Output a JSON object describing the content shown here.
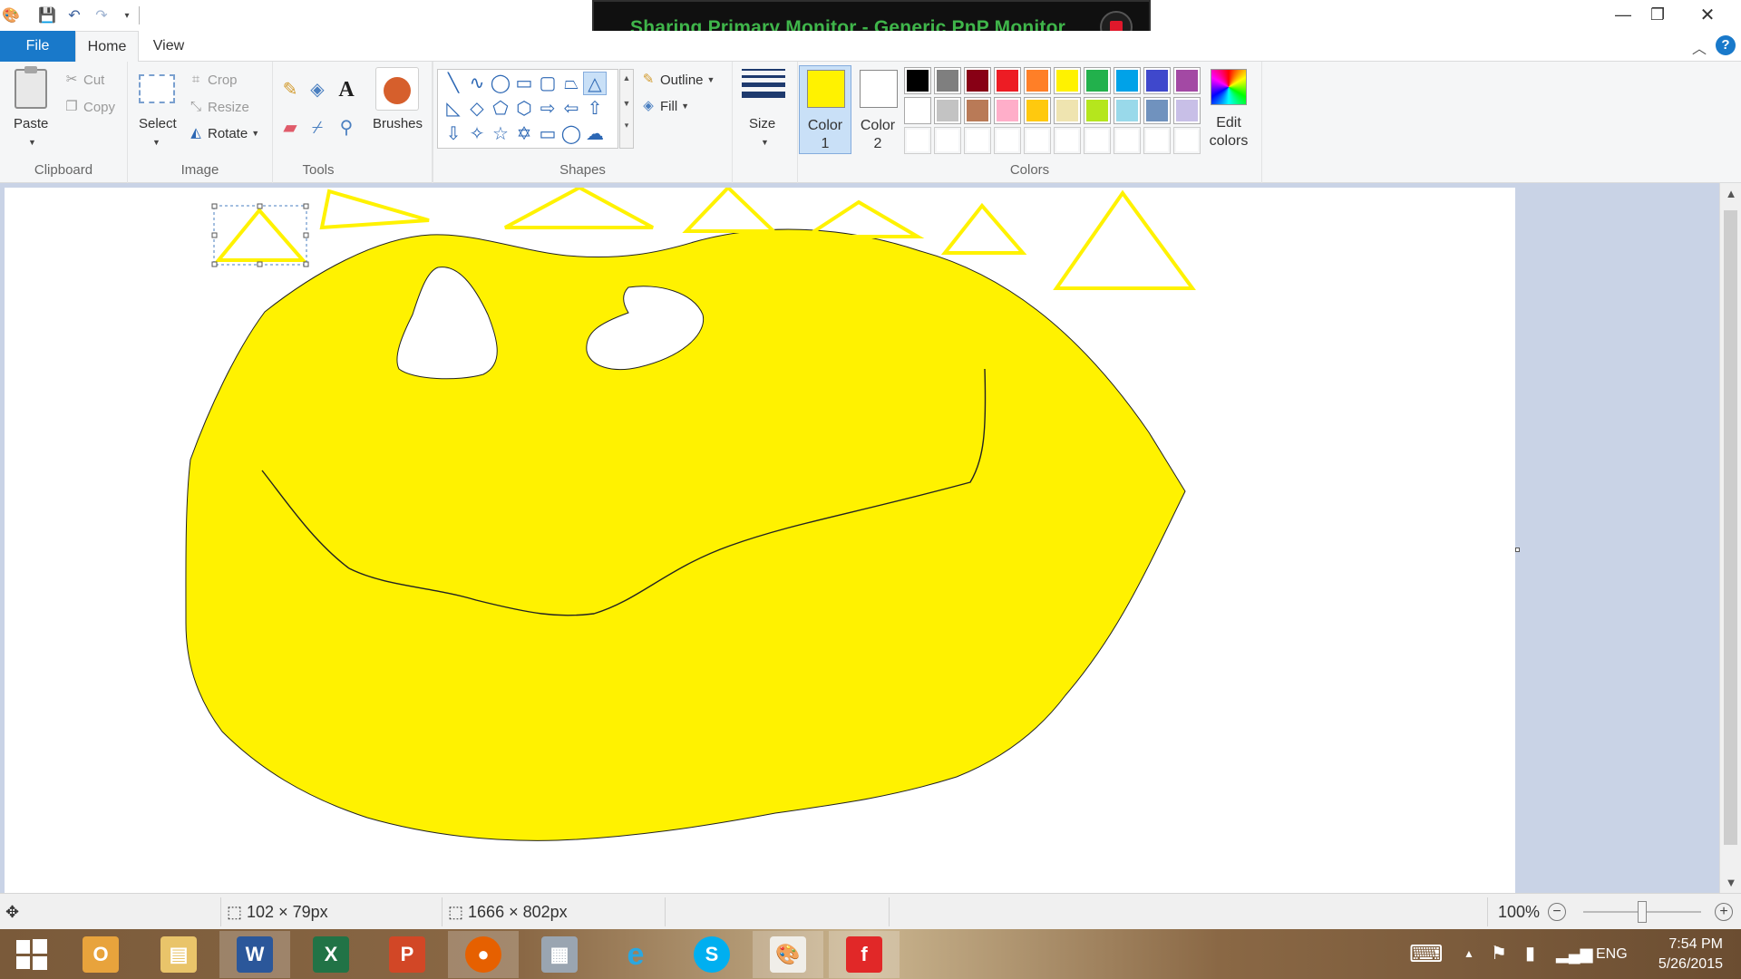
{
  "window": {
    "minimize": "—",
    "restore": "❐",
    "close": "✕"
  },
  "sharing": {
    "text": "Sharing Primary Monitor - Generic PnP Monitor"
  },
  "tabs": {
    "file": "File",
    "home": "Home",
    "view": "View"
  },
  "clipboard": {
    "paste": "Paste",
    "cut": "Cut",
    "copy": "Copy",
    "group": "Clipboard"
  },
  "image": {
    "select": "Select",
    "crop": "Crop",
    "resize": "Resize",
    "rotate": "Rotate",
    "group": "Image"
  },
  "tools": {
    "group": "Tools",
    "text_tool": "A"
  },
  "brushes": {
    "label": "Brushes"
  },
  "shapes": {
    "outline": "Outline",
    "fill": "Fill",
    "group": "Shapes"
  },
  "size": {
    "label": "Size"
  },
  "colors": {
    "color1_label": "Color",
    "color1_num": "1",
    "color2_label": "Color",
    "color2_num": "2",
    "color1": "#FFF200",
    "color2": "#FFFFFF",
    "edit_label": "Edit",
    "edit_label2": "colors",
    "group": "Colors",
    "palette_row1": [
      "#000000",
      "#7F7F7F",
      "#880015",
      "#ED1C24",
      "#FF7F27",
      "#FFF200",
      "#22B14C",
      "#00A2E8",
      "#3F48CC",
      "#A349A4"
    ],
    "palette_row2": [
      "#FFFFFF",
      "#C3C3C3",
      "#B97A57",
      "#FFAEC9",
      "#FFC90E",
      "#EFE4B0",
      "#B5E61D",
      "#99D9EA",
      "#7092BE",
      "#C8BFE7"
    ]
  },
  "status": {
    "selection_size": "102 × 79px",
    "image_size": "1666 × 802px",
    "zoom": "100%"
  },
  "taskbar": {
    "language": "ENG",
    "time": "7:54 PM",
    "date": "5/26/2015"
  }
}
